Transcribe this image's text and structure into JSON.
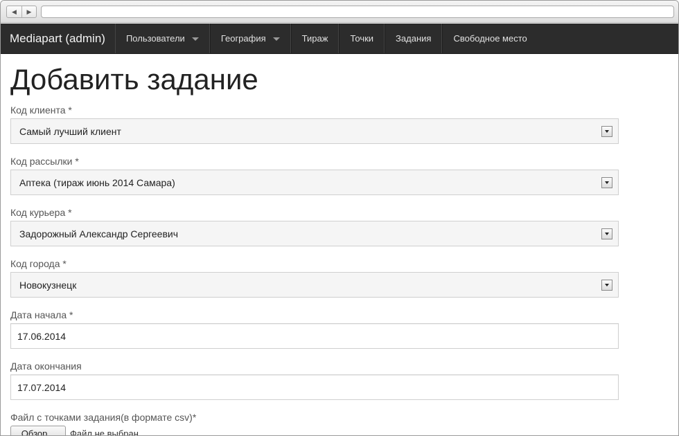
{
  "navbar": {
    "brand": "Mediapart (admin)",
    "items": [
      {
        "label": "Пользователи",
        "dropdown": true
      },
      {
        "label": "География",
        "dropdown": true
      },
      {
        "label": "Тираж",
        "dropdown": false
      },
      {
        "label": "Точки",
        "dropdown": false
      },
      {
        "label": "Задания",
        "dropdown": false
      },
      {
        "label": "Свободное место",
        "dropdown": false
      }
    ]
  },
  "page": {
    "title": "Добавить задание"
  },
  "form": {
    "client": {
      "label": "Код клиента *",
      "value": "Самый лучший клиент"
    },
    "mailing": {
      "label": "Код рассылки *",
      "value": "Аптека (тираж июнь 2014 Самара)"
    },
    "courier": {
      "label": "Код курьера *",
      "value": "Задорожный Александр Сергеевич"
    },
    "city": {
      "label": "Код города *",
      "value": "Новокузнецк"
    },
    "start_date": {
      "label": "Дата начала *",
      "value": "17.06.2014"
    },
    "end_date": {
      "label": "Дата окончания",
      "value": "17.07.2014"
    },
    "file": {
      "label": "Файл с точками задания(в формате csv)*",
      "button": "Обзор...",
      "status": "Файл не выбран."
    }
  }
}
